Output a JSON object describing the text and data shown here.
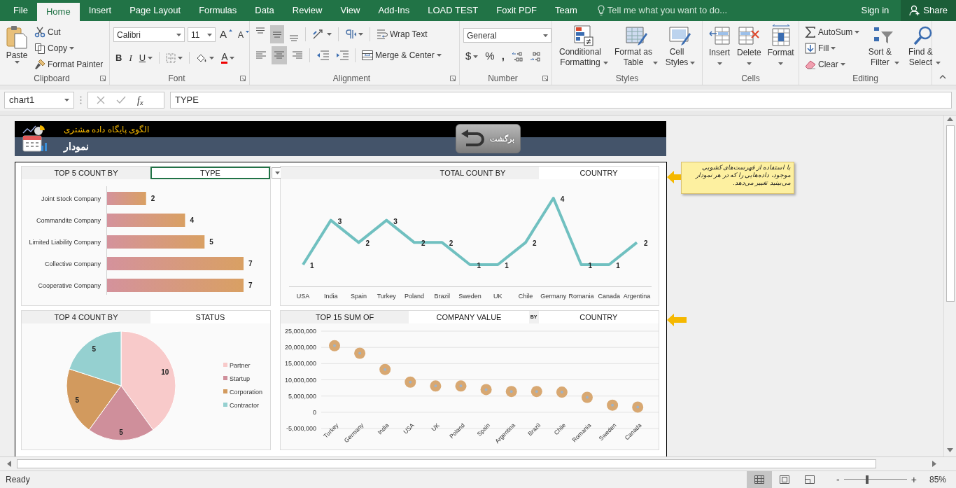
{
  "menu_tabs": [
    {
      "label": "File",
      "selected": false
    },
    {
      "label": "Home",
      "selected": true
    },
    {
      "label": "Insert",
      "selected": false
    },
    {
      "label": "Page Layout",
      "selected": false
    },
    {
      "label": "Formulas",
      "selected": false
    },
    {
      "label": "Data",
      "selected": false
    },
    {
      "label": "Review",
      "selected": false
    },
    {
      "label": "View",
      "selected": false
    },
    {
      "label": "Add-Ins",
      "selected": false
    },
    {
      "label": "LOAD TEST",
      "selected": false
    },
    {
      "label": "Foxit PDF",
      "selected": false
    },
    {
      "label": "Team",
      "selected": false
    }
  ],
  "tell_me": {
    "placeholder": "Tell me what you want to do..."
  },
  "account": {
    "sign_in": "Sign in",
    "share": "Share"
  },
  "ribbon": {
    "clipboard": {
      "label": "Clipboard",
      "paste": "Paste",
      "cut": "Cut",
      "copy": "Copy",
      "format_painter": "Format Painter"
    },
    "font": {
      "label": "Font",
      "font_name": "Calibri",
      "font_size": "11",
      "grow": "A",
      "shrink": "A",
      "font_color": "A",
      "styles": [
        {
          "kind": "bold",
          "label": "B"
        },
        {
          "kind": "italic",
          "label": "I"
        },
        {
          "kind": "underline",
          "label": "U"
        }
      ]
    },
    "alignment": {
      "label": "Alignment",
      "wrap_text": "Wrap Text",
      "merge_center": "Merge & Center",
      "vertical": [
        {
          "selected": false
        },
        {
          "selected": true
        },
        {
          "selected": false
        }
      ],
      "horizontal": [
        {
          "selected": false
        },
        {
          "selected": true
        },
        {
          "selected": false
        }
      ]
    },
    "number": {
      "label": "Number",
      "format": "General",
      "currency": "$",
      "percent": "%",
      "comma": ","
    },
    "styles": {
      "label": "Styles",
      "buttons": [
        {
          "kind": "conditional",
          "label": "Conditional Formatting"
        },
        {
          "kind": "table",
          "label": "Format as Table"
        },
        {
          "kind": "cell",
          "label": "Cell Styles"
        }
      ]
    },
    "cells": {
      "label": "Cells",
      "buttons": [
        {
          "kind": "insert",
          "label": "Insert"
        },
        {
          "kind": "delete",
          "label": "Delete"
        },
        {
          "kind": "format",
          "label": "Format"
        }
      ]
    },
    "editing": {
      "label": "Editing",
      "autosum": "AutoSum",
      "fill": "Fill",
      "clear": "Clear",
      "sort_filter": "Sort & Filter",
      "find_select": "Find & Select"
    }
  },
  "formula_bar": {
    "name_box": "chart1",
    "fx": "f$_{x}$",
    "formula": "TYPE"
  },
  "banner": {
    "subtitle": "الگوی پایگاه داده مشتری",
    "title": "نمودار",
    "back_button": "برگشت"
  },
  "note": "با استفاده از فهرست‌های کشویی موجود، داده‌هایی را که در هر نمودار می‌بینید تغییر می‌دهد.",
  "panels": [
    {
      "header": [
        {
          "kind": "label",
          "text": "TOP 5 COUNT BY"
        },
        {
          "kind": "field",
          "text": "TYPE",
          "selected": true,
          "dropdown": true
        }
      ],
      "chart_data": {
        "type": "bar",
        "orientation": "horizontal",
        "categories": [
          "Joint Stock Company",
          "Commandite Company",
          "Limited Liability Company",
          "Collective Company",
          "Cooperative Company"
        ],
        "values": [
          2,
          4,
          5,
          7,
          7
        ],
        "data_labels": true
      }
    },
    {
      "header": [
        {
          "kind": "label",
          "text": "TOTAL COUNT BY"
        },
        {
          "kind": "field",
          "text": "COUNTRY",
          "selected": false,
          "dropdown": false
        }
      ],
      "chart_data": {
        "type": "line",
        "categories": [
          "USA",
          "India",
          "Spain",
          "Turkey",
          "Poland",
          "Brazil",
          "Sweden",
          "UK",
          "Chile",
          "Germany",
          "Romania",
          "Canada",
          "Argentina"
        ],
        "values": [
          1,
          3,
          2,
          3,
          2,
          2,
          1,
          1,
          2,
          4,
          1,
          1,
          2
        ],
        "data_labels": true
      }
    },
    {
      "header": [
        {
          "kind": "label",
          "text": "TOP 4 COUNT BY"
        },
        {
          "kind": "field",
          "text": "STATUS",
          "selected": false,
          "dropdown": false
        }
      ],
      "chart_data": {
        "type": "pie",
        "categories": [
          "Partner",
          "Startup",
          "Corporation",
          "Contractor"
        ],
        "values": [
          10,
          5,
          5,
          5
        ],
        "colors": [
          "#f8caca",
          "#cf8f9b",
          "#d29a5e",
          "#95d0d0"
        ],
        "data_labels": true,
        "legend": true
      }
    },
    {
      "header": [
        {
          "kind": "label",
          "text": "TOP 15 SUM OF"
        },
        {
          "kind": "field",
          "text": "COMPANY VALUE",
          "selected": false,
          "dropdown": false
        },
        {
          "kind": "label",
          "text": "BY"
        },
        {
          "kind": "field",
          "text": "COUNTRY",
          "selected": false,
          "dropdown": false
        }
      ],
      "chart_data": {
        "type": "scatter",
        "categories": [
          "Turkey",
          "Germany",
          "India",
          "USA",
          "UK",
          "Poland",
          "Spain",
          "Argentina",
          "Brazil",
          "Chile",
          "Romania",
          "Sweden",
          "Canada"
        ],
        "values": [
          20500000,
          18200000,
          13200000,
          9300000,
          8100000,
          8100000,
          7000000,
          6400000,
          6400000,
          6200000,
          4600000,
          2200000,
          1600000
        ],
        "grid": true,
        "ylim": [
          -5000000,
          25000000
        ],
        "yticks": [
          {
            "value": 25000000,
            "label": "25,000,000"
          },
          {
            "value": 20000000,
            "label": "20,000,000"
          },
          {
            "value": 15000000,
            "label": "15,000,000"
          },
          {
            "value": 10000000,
            "label": "10,000,000"
          },
          {
            "value": 5000000,
            "label": "5,000,000"
          },
          {
            "value": 0,
            "label": "0"
          },
          {
            "value": -5000000,
            "label": "-5,000,000"
          }
        ]
      }
    }
  ],
  "status_bar": {
    "text": "Ready",
    "views": [
      {
        "selected": true
      },
      {
        "selected": false
      },
      {
        "selected": false
      }
    ],
    "zoom_out": "-",
    "zoom_in": "+",
    "zoom_slider": {
      "level": 0.36
    },
    "zoom": "85%"
  }
}
